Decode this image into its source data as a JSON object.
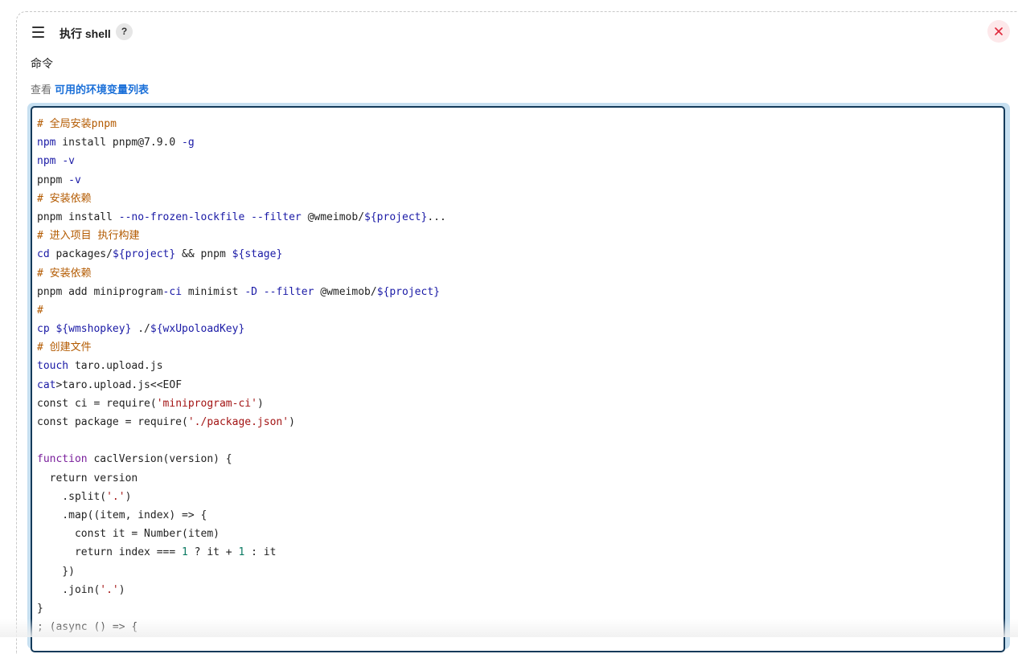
{
  "step": {
    "title": "执行 shell",
    "help": "?",
    "icons": {
      "drag": "hamburger-menu-icon",
      "help": "question-mark-icon",
      "close": "close-x-icon"
    },
    "close_color": "#e0283a"
  },
  "field": {
    "label": "命令",
    "env_prefix": "查看",
    "env_link": "可用的环境变量列表"
  },
  "editor": {
    "lines": [
      [
        {
          "t": "# 全局安装pnpm",
          "c": "c"
        }
      ],
      [
        {
          "t": "npm",
          "c": "kw"
        },
        {
          "t": " install pnpm@7.9.0 "
        },
        {
          "t": "-g",
          "c": "kw"
        }
      ],
      [
        {
          "t": "npm",
          "c": "kw"
        },
        {
          "t": " "
        },
        {
          "t": "-v",
          "c": "kw"
        }
      ],
      [
        {
          "t": "pnpm "
        },
        {
          "t": "-v",
          "c": "kw"
        }
      ],
      [
        {
          "t": "# 安装依赖",
          "c": "c"
        }
      ],
      [
        {
          "t": "pnpm install "
        },
        {
          "t": "--no-frozen-lockfile",
          "c": "kw"
        },
        {
          "t": " "
        },
        {
          "t": "--filter",
          "c": "kw"
        },
        {
          "t": " @wmeimob/"
        },
        {
          "t": "${project}",
          "c": "kw"
        },
        {
          "t": "..."
        }
      ],
      [
        {
          "t": "# 进入项目 执行构建",
          "c": "c"
        }
      ],
      [
        {
          "t": "cd",
          "c": "kw"
        },
        {
          "t": " packages/"
        },
        {
          "t": "${project}",
          "c": "kw"
        },
        {
          "t": " && pnpm "
        },
        {
          "t": "${stage}",
          "c": "kw"
        }
      ],
      [
        {
          "t": "# 安装依赖",
          "c": "c"
        }
      ],
      [
        {
          "t": "pnpm add miniprogram"
        },
        {
          "t": "-ci",
          "c": "kw"
        },
        {
          "t": " minimist "
        },
        {
          "t": "-D",
          "c": "kw"
        },
        {
          "t": " "
        },
        {
          "t": "--filter",
          "c": "kw"
        },
        {
          "t": " @wmeimob/"
        },
        {
          "t": "${project}",
          "c": "kw"
        }
      ],
      [
        {
          "t": "#",
          "c": "c"
        }
      ],
      [
        {
          "t": "cp",
          "c": "kw"
        },
        {
          "t": " "
        },
        {
          "t": "${wmshopkey}",
          "c": "kw"
        },
        {
          "t": " ./"
        },
        {
          "t": "${wxUpoloadKey}",
          "c": "kw"
        }
      ],
      [
        {
          "t": "# 创建文件",
          "c": "c"
        }
      ],
      [
        {
          "t": "touch",
          "c": "kw"
        },
        {
          "t": " taro.upload.js"
        }
      ],
      [
        {
          "t": "cat",
          "c": "kw"
        },
        {
          "t": ">taro.upload.js<<EOF"
        }
      ],
      [
        {
          "t": "const ci = require("
        },
        {
          "t": "'miniprogram-ci'",
          "c": "s"
        },
        {
          "t": ")"
        }
      ],
      [
        {
          "t": "const package = require("
        },
        {
          "t": "'./package.json'",
          "c": "s"
        },
        {
          "t": ")"
        }
      ],
      [],
      [
        {
          "t": "function",
          "c": "fn"
        },
        {
          "t": " caclVersion(version) {"
        }
      ],
      [
        {
          "t": "  return version"
        }
      ],
      [
        {
          "t": "    .split("
        },
        {
          "t": "'.'",
          "c": "s"
        },
        {
          "t": ")"
        }
      ],
      [
        {
          "t": "    .map((item, index) => {"
        }
      ],
      [
        {
          "t": "      const it = Number(item)"
        }
      ],
      [
        {
          "t": "      return index === "
        },
        {
          "t": "1",
          "c": "n"
        },
        {
          "t": " ? it + "
        },
        {
          "t": "1",
          "c": "n"
        },
        {
          "t": " : it"
        }
      ],
      [
        {
          "t": "    })"
        }
      ],
      [
        {
          "t": "    .join("
        },
        {
          "t": "'.'",
          "c": "s"
        },
        {
          "t": ")"
        }
      ],
      [
        {
          "t": "}"
        }
      ],
      [
        {
          "t": "; (async () => {"
        }
      ]
    ]
  }
}
